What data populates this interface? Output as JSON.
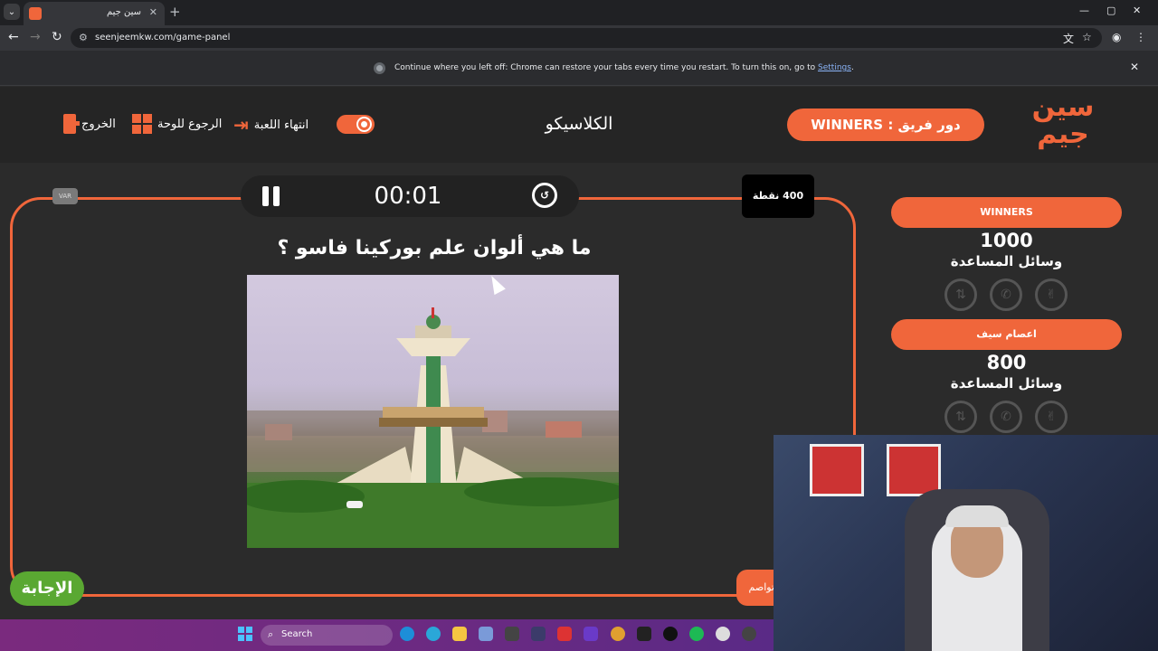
{
  "browser": {
    "tab_title": "سين جيم",
    "tab_close": "✕",
    "new_tab": "+",
    "url": "seenjeemkw.com/game-panel",
    "window_controls": {
      "minimize": "—",
      "restore": "▢",
      "close": "✕"
    },
    "infobar": {
      "message": "Continue where you left off: Chrome can restore your tabs every time you restart. To turn this on, go to",
      "link": "Settings",
      "tail": ".",
      "close": "✕"
    }
  },
  "header": {
    "logo": "سين جيم",
    "turn_label": "دور فريق : WINNERS",
    "game_title": "الكلاسيكو",
    "end_game": "انتهاء اللعبة",
    "back_to_board": "الرجوع للوحة",
    "exit": "الخروج"
  },
  "question_panel": {
    "timer": "00:01",
    "points": "400 نقطة",
    "var_badge": "VAR",
    "question": "ما هي ألوان علم بوركينا فاسو ؟",
    "answer_button": "الإجابة",
    "continue_button": "تواصم"
  },
  "teams": [
    {
      "name": "WINNERS",
      "score": "1000",
      "aids_label": "وسائل المساعدة"
    },
    {
      "name": "اعصام سيف",
      "score": "800",
      "aids_label": "وسائل المساعدة"
    }
  ],
  "aid_icons": [
    "swap-icon",
    "phone-icon",
    "two-answers-icon"
  ],
  "taskbar": {
    "search_label": "Search"
  },
  "colors": {
    "accent": "#f0663b",
    "answer_green": "#5aa832",
    "panel_bg": "#2b2b2b"
  }
}
